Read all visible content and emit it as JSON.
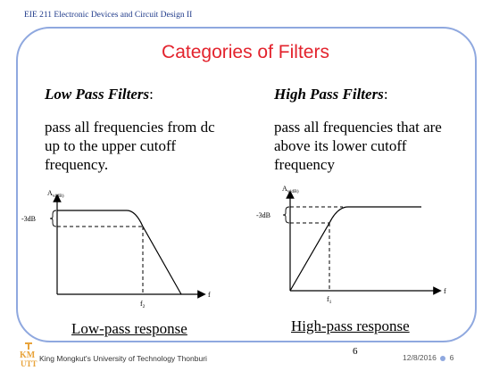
{
  "header": {
    "course": "EIE 211 Electronic Devices and Circuit Design II"
  },
  "slide": {
    "title": "Categories of Filters",
    "left": {
      "heading": "Low Pass Filters",
      "colon": ":",
      "body": [
        "pass all frequencies from dc",
        "up to the upper cutoff",
        "frequency."
      ],
      "graph": {
        "y_label": "A",
        "y_sub": "v(dB)",
        "db_label": "-3dB",
        "x_label": "f",
        "cutoff_label": "f",
        "cutoff_sub": "2"
      },
      "caption": "Low-pass response"
    },
    "right": {
      "heading": "High Pass Filters",
      "colon": ":",
      "body": [
        "pass all frequencies that are",
        "above its lower cutoff",
        "frequency"
      ],
      "graph": {
        "y_label": "A",
        "y_sub": "v(dB)",
        "db_label": "-3dB",
        "x_label": "f",
        "cutoff_label": "f",
        "cutoff_sub": "1"
      },
      "caption": "High-pass response"
    }
  },
  "footer": {
    "university": "King Mongkut's University of Technology Thonburi",
    "page": "6",
    "date": "12/8/2016",
    "slide_number": "6",
    "logo_text": "KMUTT"
  },
  "colors": {
    "title": "#e3232d",
    "frame": "#8fa8df",
    "header": "#1f3a8a"
  }
}
